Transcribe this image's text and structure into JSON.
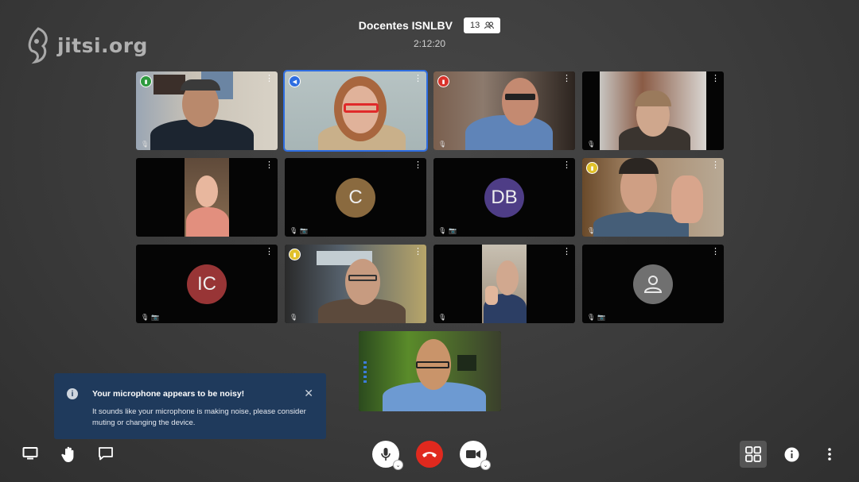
{
  "logo": {
    "text": "jitsi.org"
  },
  "meeting": {
    "title": "Docentes ISNLBV",
    "participant_count": "13",
    "timer": "2:12:20"
  },
  "participants": [
    {
      "type": "video",
      "signal": "green"
    },
    {
      "type": "video",
      "signal": "blue",
      "active": true
    },
    {
      "type": "video",
      "signal": "red"
    },
    {
      "type": "video"
    },
    {
      "type": "video"
    },
    {
      "type": "avatar",
      "initials": "C",
      "color": "#8a6a3f"
    },
    {
      "type": "avatar",
      "initials": "DB",
      "color": "#4e3d86"
    },
    {
      "type": "video",
      "signal": "yellow"
    },
    {
      "type": "avatar",
      "initials": "IC",
      "color": "#983536"
    },
    {
      "type": "video",
      "signal": "yellow"
    },
    {
      "type": "video"
    },
    {
      "type": "avatar",
      "initials": "",
      "color": "#707070"
    },
    {
      "type": "video"
    }
  ],
  "notification": {
    "title": "Your microphone appears to be noisy!",
    "body": "It sounds like your microphone is making noise, please consider muting or changing the device."
  },
  "toolbar": {
    "left": [
      "screen-share-icon",
      "raise-hand-icon",
      "chat-icon"
    ],
    "center": [
      "microphone-icon",
      "hangup-icon",
      "camera-icon"
    ],
    "right": [
      "tile-view-icon",
      "info-icon",
      "more-options-icon"
    ]
  },
  "colors": {
    "accent": "#2e6de1",
    "hangup": "#e0291e",
    "notification_bg": "#1f3a5c"
  }
}
